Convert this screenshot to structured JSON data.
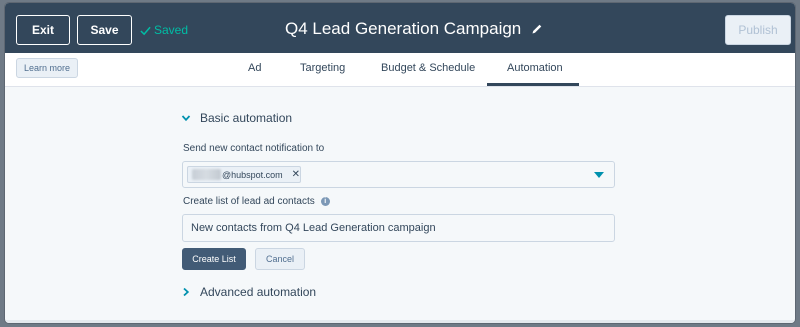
{
  "header": {
    "exit_label": "Exit",
    "save_label": "Save",
    "saved_status": "Saved",
    "campaign_title": "Q4 Lead Generation Campaign",
    "publish_label": "Publish"
  },
  "tabbar": {
    "learn_more_label": "Learn more",
    "tabs": [
      {
        "label": "Ad"
      },
      {
        "label": "Targeting"
      },
      {
        "label": "Budget & Schedule"
      },
      {
        "label": "Automation"
      }
    ],
    "active_tab": "Automation"
  },
  "basic_automation": {
    "heading": "Basic automation",
    "notification_label": "Send new contact notification to",
    "recipient_chip": "@hubspot.com",
    "chip_remove_glyph": "✕",
    "list_label": "Create list of lead ad contacts",
    "info_glyph": "i",
    "list_name_value": "New contacts from Q4 Lead Generation campaign",
    "create_list_label": "Create List",
    "cancel_label": "Cancel"
  },
  "advanced_automation": {
    "heading": "Advanced automation"
  },
  "colors": {
    "header_bg": "#33475b",
    "saved_accent": "#00bda5",
    "caret_accent": "#0091ae",
    "primary_button": "#425b76"
  }
}
